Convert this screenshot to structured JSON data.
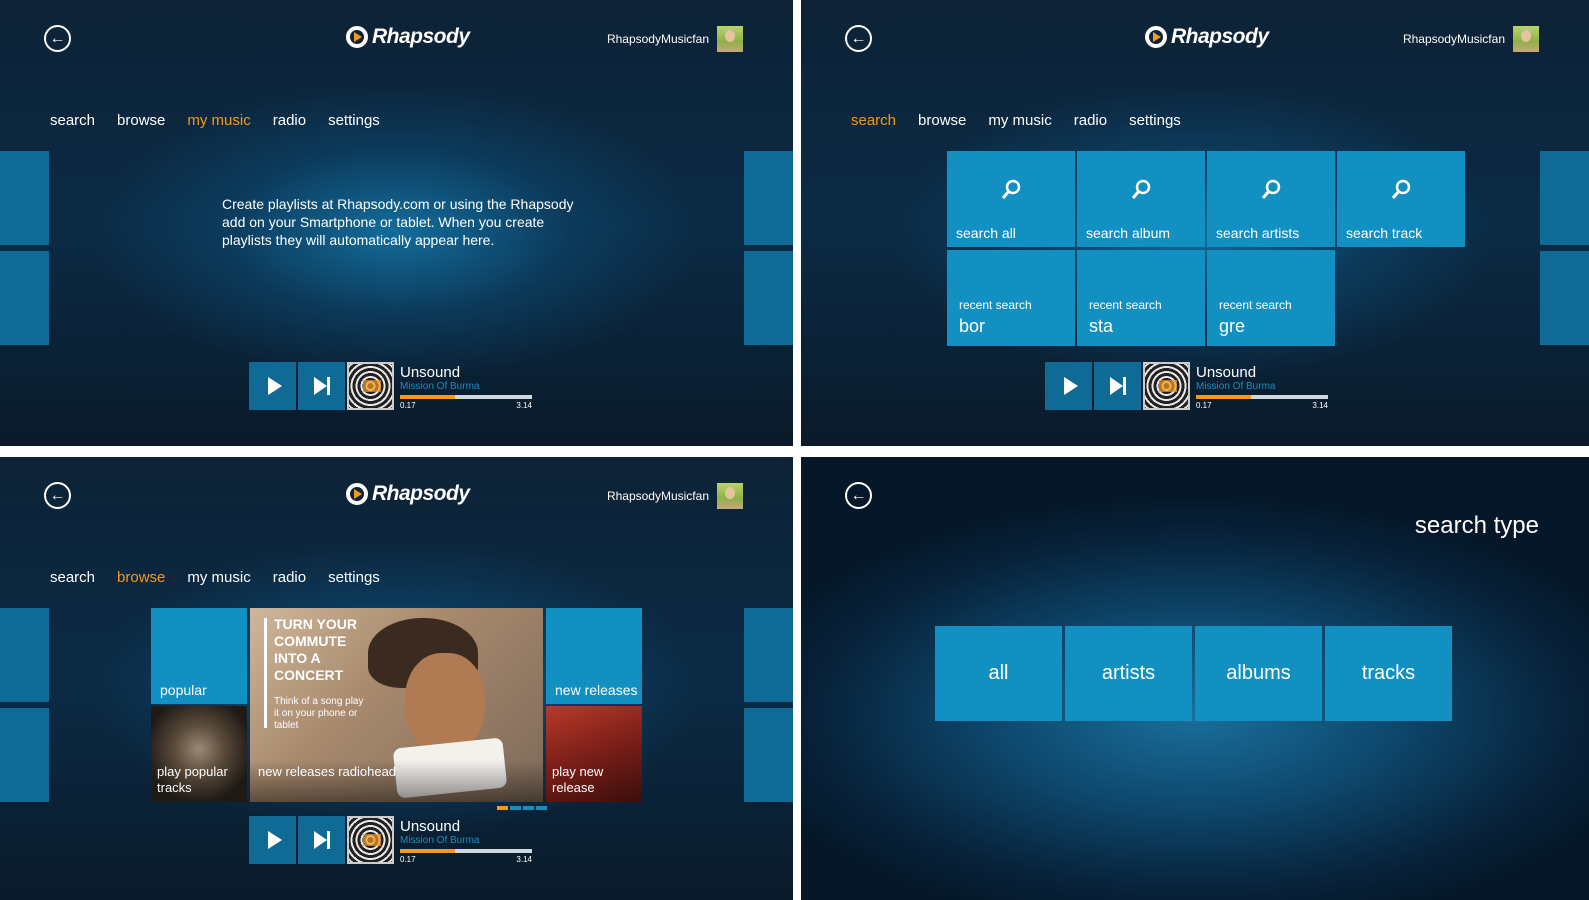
{
  "common": {
    "brand": "Rhapsody",
    "username": "RhapsodyMusicfan",
    "nav": [
      "search",
      "browse",
      "my music",
      "radio",
      "settings"
    ]
  },
  "player": {
    "song": "Unsound",
    "artist": "Mission Of Burma",
    "elapsed": "0.17",
    "duration": "3.14",
    "progress": 0.42
  },
  "mymusic": {
    "active_tab": "my music",
    "message": "Create playlists at Rhapsody.com or using the Rhapsody add on your Smartphone or tablet. When you create playlists they will automatically appear here."
  },
  "search": {
    "active_tab": "search",
    "tiles": [
      "search all",
      "search album",
      "search artists",
      "search track"
    ],
    "recent_label": "recent search",
    "recent": [
      "bor",
      "sta",
      "gre"
    ]
  },
  "browse": {
    "active_tab": "browse",
    "popular": "popular",
    "play_popular": "play popular tracks",
    "feature_headline": "TURN YOUR COMMUTE INTO A CONCERT",
    "feature_sub": "Think of a song play it on your phone or tablet",
    "feature_caption": "new releases radiohead",
    "new_releases": "new releases",
    "play_new": "play new release"
  },
  "search_type": {
    "title": "search type",
    "options": [
      "all",
      "artists",
      "albums",
      "tracks"
    ]
  },
  "colors": {
    "accent": "#f39a1e",
    "tile": "#1290c2",
    "tile_dark": "#0f6b96"
  }
}
